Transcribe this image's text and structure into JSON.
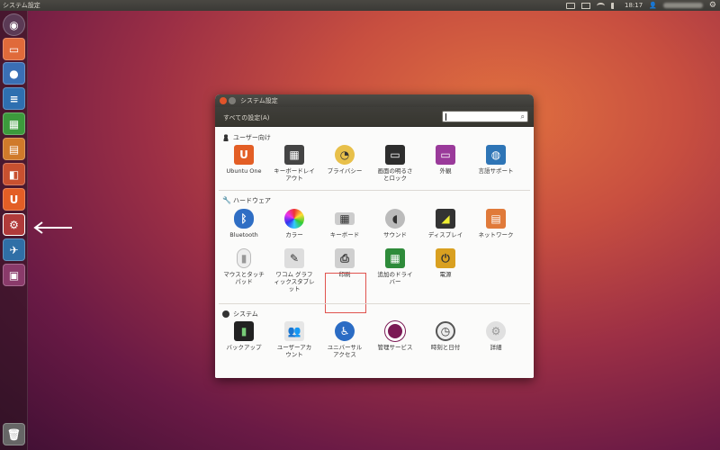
{
  "topbar": {
    "app_title": "システム設定",
    "time": "18:17"
  },
  "window": {
    "title": "システム設定",
    "all_settings": "すべての設定(A)",
    "search_placeholder": ""
  },
  "sections": [
    {
      "title": "ユーザー向け",
      "items": [
        {
          "label": "Ubuntu One",
          "icon": "ubuntu-one-icon"
        },
        {
          "label": "キーボードレイ\nアウト",
          "icon": "keyboard-layout-icon"
        },
        {
          "label": "プライバシー",
          "icon": "privacy-icon"
        },
        {
          "label": "画面の明るさ\nとロック",
          "icon": "brightness-lock-icon"
        },
        {
          "label": "外観",
          "icon": "appearance-icon"
        },
        {
          "label": "言語サポート",
          "icon": "language-icon"
        }
      ]
    },
    {
      "title": "ハードウェア",
      "items": [
        {
          "label": "Bluetooth",
          "icon": "bluetooth-icon"
        },
        {
          "label": "カラー",
          "icon": "color-icon"
        },
        {
          "label": "キーボード",
          "icon": "keyboard-icon"
        },
        {
          "label": "サウンド",
          "icon": "sound-icon"
        },
        {
          "label": "ディスプレイ",
          "icon": "display-icon"
        },
        {
          "label": "ネットワーク",
          "icon": "network-icon"
        },
        {
          "label": "マウスとタッチ\nパッド",
          "icon": "mouse-icon"
        },
        {
          "label": "ワコム グラフ\nィックスタブレ\nット",
          "icon": "wacom-icon"
        },
        {
          "label": "印刷",
          "icon": "printer-icon"
        },
        {
          "label": "追加のドライ\nバー",
          "icon": "drivers-icon"
        },
        {
          "label": "電源",
          "icon": "power-icon"
        }
      ]
    },
    {
      "title": "システム",
      "items": [
        {
          "label": "バックアップ",
          "icon": "backup-icon"
        },
        {
          "label": "ユーザーアカ\nウント",
          "icon": "user-accounts-icon"
        },
        {
          "label": "ユニバーサル\nアクセス",
          "icon": "universal-access-icon"
        },
        {
          "label": "管理サービス",
          "icon": "management-service-icon"
        },
        {
          "label": "時刻と日付",
          "icon": "time-date-icon"
        },
        {
          "label": "詳細",
          "icon": "details-icon"
        }
      ]
    }
  ],
  "colors": {
    "accent_highlight": "#e0534e",
    "ubuntu_orange": "#e95420"
  }
}
